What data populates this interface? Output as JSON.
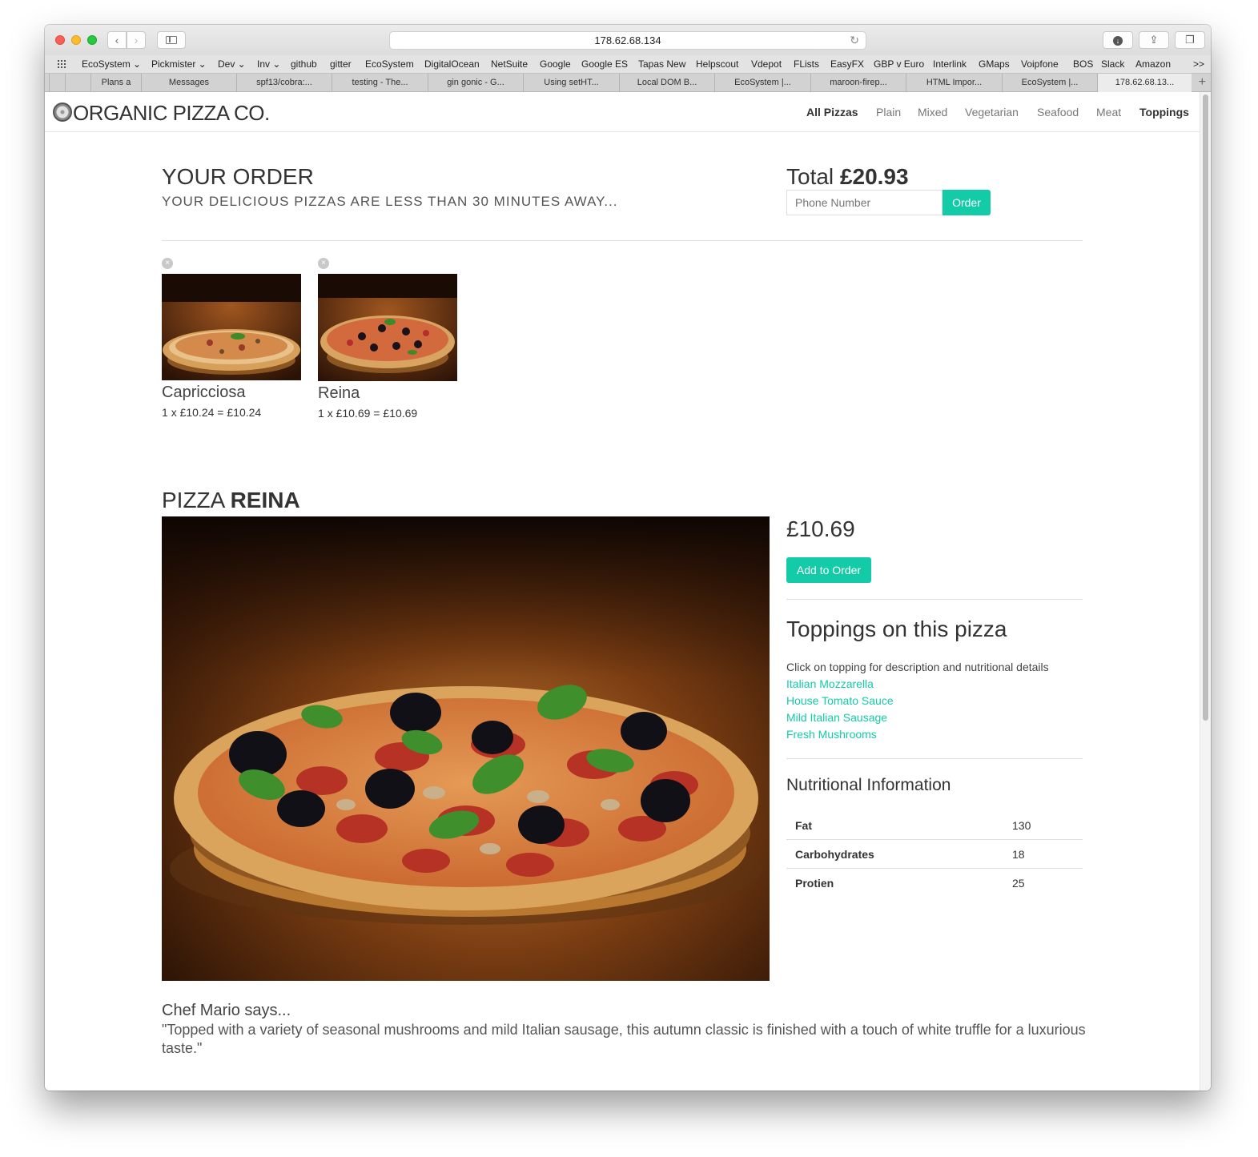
{
  "browser": {
    "url": "178.62.68.134",
    "bookmarks": [
      "EcoSystem ⌄",
      "Pickmister ⌄",
      "Dev ⌄",
      "Inv ⌄",
      "github",
      "gitter",
      "EcoSystem",
      "DigitalOcean",
      "NetSuite",
      "Google",
      "Google ES",
      "Tapas New",
      "Helpscout",
      "Vdepot",
      "FLists",
      "EasyFX",
      "GBP v Euro",
      "Interlink",
      "GMaps",
      "Voipfone",
      "BOS",
      "Slack",
      "Amazon",
      ">>"
    ],
    "tabs": [
      "Plans a",
      "Messages",
      "spf13/cobra:...",
      "testing - The...",
      "gin gonic - G...",
      "Using setHT...",
      "Local DOM B...",
      "EcoSystem |...",
      "maroon-firep...",
      "HTML Impor...",
      "EcoSystem |...",
      "178.62.68.13..."
    ]
  },
  "nav": {
    "brand": "ORGANIC PIZZA CO.",
    "links": [
      "All Pizzas",
      "Plain",
      "Mixed",
      "Vegetarian",
      "Seafood",
      "Meat",
      "Toppings"
    ]
  },
  "order": {
    "title": "YOUR ORDER",
    "subtitle": "YOUR DELICIOUS PIZZAS ARE LESS THAN 30 MINUTES AWAY...",
    "total_label": "Total",
    "total_value": "£20.93",
    "phone_placeholder": "Phone Number",
    "order_button": "Order",
    "remove_icon": "×",
    "items": [
      {
        "name": "Capricciosa",
        "qty": "1",
        "x": "x",
        "price": "£10.24",
        "eq": "=",
        "line_total": "£10.24"
      },
      {
        "name": "Reina",
        "qty": "1",
        "x": "x",
        "price": "£10.69",
        "eq": "=",
        "line_total": "£10.69"
      }
    ]
  },
  "pizza": {
    "title_prefix": "PIZZA",
    "title_name": "REINA",
    "price": "£10.69",
    "add_button": "Add to Order",
    "toppings_title": "Toppings on this pizza",
    "toppings_hint": "Click on topping for description and nutritional details",
    "toppings": [
      "Italian Mozzarella",
      "House Tomato Sauce",
      "Mild Italian Sausage",
      "Fresh Mushrooms"
    ],
    "nutrition_title": "Nutritional Information",
    "nutrition": [
      {
        "label": "Fat",
        "value": "130"
      },
      {
        "label": "Carbohydrates",
        "value": "18"
      },
      {
        "label": "Protien",
        "value": "25"
      }
    ],
    "chef_title": "Chef Mario says...",
    "chef_quote": "\"Topped with a variety of seasonal mushrooms and mild Italian sausage, this autumn classic is finished with a touch of white truffle for a luxurious taste.\""
  },
  "colors": {
    "accent": "#13cba6",
    "text": "#333333"
  }
}
